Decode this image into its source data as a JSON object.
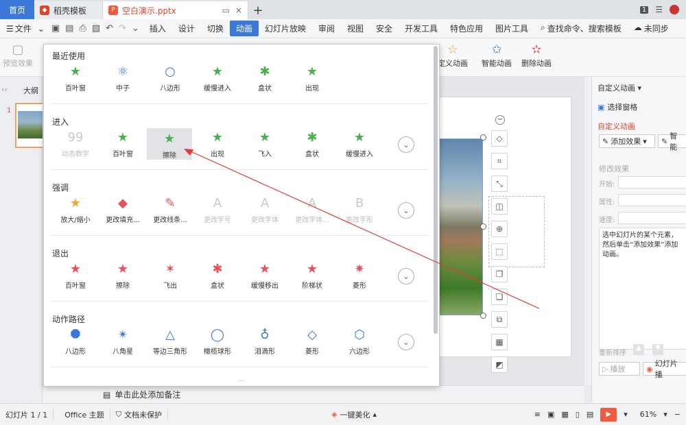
{
  "tabs": {
    "home": "首页",
    "template": "稻壳模板",
    "document": "空白演示.pptx",
    "page_count": "1"
  },
  "menu": {
    "file": "文件",
    "items": [
      "插入",
      "设计",
      "切换",
      "动画",
      "幻灯片放映",
      "审阅",
      "视图",
      "安全",
      "开发工具",
      "特色应用",
      "图片工具"
    ],
    "active": "动画",
    "search": "查找命令、搜索模板",
    "sync": "未同步"
  },
  "ribbon": {
    "preview": "预览效果",
    "custom_anim": "定义动画",
    "smart_anim": "智能动画",
    "delete_anim": "删除动画"
  },
  "left": {
    "outline": "大纲",
    "slide_number": "1"
  },
  "popup": {
    "recent": {
      "title": "最近使用",
      "items": [
        "百叶窗",
        "中子",
        "八边形",
        "缓慢进入",
        "盒状",
        "出现"
      ]
    },
    "enter": {
      "title": "进入",
      "items": [
        "动态数字",
        "百叶窗",
        "擦除",
        "出现",
        "飞入",
        "盒状",
        "缓慢进入"
      ]
    },
    "emphasis": {
      "title": "强调",
      "items": [
        "放大/缩小",
        "更改填充...",
        "更改线条...",
        "更改字号",
        "更改字体",
        "更改字体...",
        "更改字形"
      ]
    },
    "exit": {
      "title": "退出",
      "items": [
        "百叶窗",
        "擦除",
        "飞出",
        "盒状",
        "缓慢移出",
        "阶梯状",
        "菱形"
      ]
    },
    "path": {
      "title": "动作路径",
      "items": [
        "八边形",
        "八角星",
        "等边三角形",
        "橄榄球形",
        "泪滴形",
        "菱形",
        "六边形"
      ]
    },
    "dots": "···"
  },
  "notes": "单击此处添加备注",
  "right": {
    "title": "自定义动画",
    "select_pane": "选择窗格",
    "custom_anim": "自定义动画",
    "add_effect": "添加效果",
    "smart": "智能",
    "modify": "修改效果",
    "start": "开始:",
    "property": "属性:",
    "speed": "速度:",
    "hint": "选中幻灯片的某个元素，然后单击“添加效果”添加动画。",
    "reorder": "重新排序",
    "play": "播放",
    "slideshow": "幻灯片播"
  },
  "status": {
    "slide": "幻灯片 1 / 1",
    "theme": "Office 主题",
    "protect": "文档未保护",
    "beautify": "一键美化",
    "zoom": "61%"
  },
  "colors": {
    "accent": "#3b78d8",
    "effect_green": "#4caf50",
    "effect_red": "#e8505b",
    "arrow": "#e53935"
  }
}
